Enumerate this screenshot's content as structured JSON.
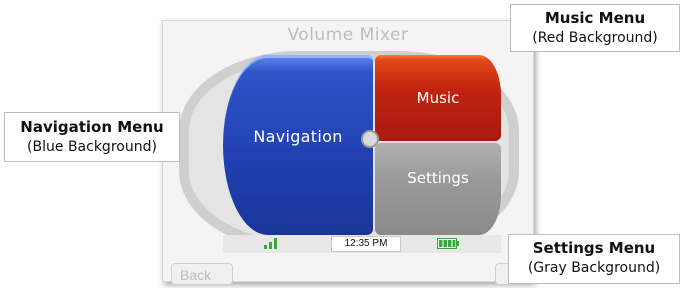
{
  "screen": {
    "title": "Volume Mixer",
    "back_label": "Back",
    "panels": {
      "navigation": "Navigation",
      "music": "Music",
      "settings": "Settings"
    },
    "status_bar": {
      "time": "12:35 PM",
      "signal_icon": "signal-bars-icon",
      "battery_icon": "battery-icon"
    }
  },
  "callouts": {
    "music": {
      "title": "Music Menu",
      "subtitle": "(Red Background)"
    },
    "navigation": {
      "title": "Navigation Menu",
      "subtitle": "(Blue Background)"
    },
    "settings": {
      "title": "Settings Menu",
      "subtitle": "(Gray Background)"
    }
  },
  "colors": {
    "navigation": "#203fb0",
    "music": "#c02410",
    "settings": "#9a9a9a",
    "status_green": "#3aa83a"
  }
}
